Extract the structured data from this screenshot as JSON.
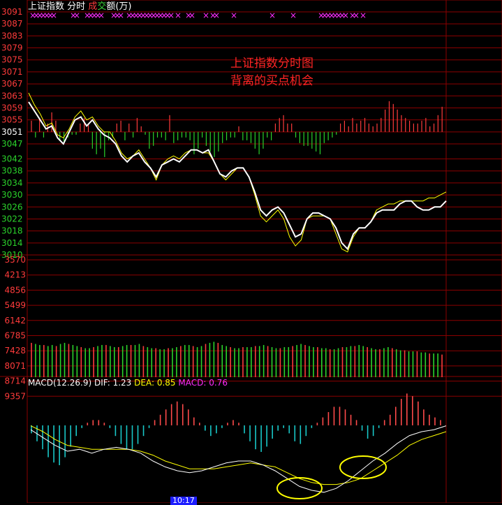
{
  "header": {
    "index_name": "上证指数",
    "mode": "分时",
    "turnover_part1": "成",
    "turnover_part2": "交",
    "turnover_part3": "额",
    "turnover_unit": "(万)"
  },
  "annotation": {
    "line1": "上证指数分时图",
    "line2": "背离的买点机会"
  },
  "price_axis": {
    "labels": [
      "3091",
      "3087",
      "3083",
      "3079",
      "3075",
      "3071",
      "3067",
      "3063",
      "3059",
      "3055",
      "3051",
      "3047",
      "3042",
      "3038",
      "3034",
      "3030",
      "3026",
      "3022",
      "3018",
      "3014",
      "3010"
    ],
    "prev_close": 3051
  },
  "volume_axis": {
    "labels": [
      "3570",
      "4213",
      "4856",
      "5499",
      "6142",
      "6785",
      "7428",
      "8071",
      "8714",
      "9357"
    ]
  },
  "macd": {
    "title": "MACD(12.26.9)",
    "dif_label": "DIF:",
    "dif_value": "1.23",
    "dea_label": "DEA:",
    "dea_value": "0.85",
    "macd_label": "MACD:",
    "macd_value": "0.76"
  },
  "time_axis": {
    "cursor_time": "10:17"
  },
  "colors": {
    "background": "#000000",
    "grid": "#8b0000",
    "up": "#ff3b3b",
    "down": "#2bd42b",
    "price_line": "#ffffff",
    "avg_line": "#ffff00",
    "macd_neg": "#19c8c8",
    "macd_pos": "#ff4a4a",
    "dea": "#ffff00",
    "dif": "#ffffff",
    "highlight": "#ffff00",
    "time_badge": "#1c1cff"
  },
  "chart_data": [
    {
      "type": "line",
      "title": "",
      "series": [
        {
          "name": "",
          "values": [
            3061,
            3058,
            3055,
            3052,
            3053,
            3049,
            3047,
            3051,
            3055,
            3056,
            3053,
            3055,
            3052,
            3050,
            3049,
            3047,
            3043,
            3041,
            3043,
            3044,
            3041,
            3039,
            3036,
            3040,
            3041,
            3042,
            3041,
            3043,
            3045,
            3045,
            3044,
            3045,
            3041,
            3037,
            3036,
            3038,
            3039,
            3039,
            3036,
            3031,
            3025,
            3023,
            3025,
            3026,
            3024,
            3020,
            3016,
            3017,
            3022,
            3024,
            3024,
            3023,
            3022,
            3019,
            3014,
            3012,
            3017,
            3019,
            3019,
            3021,
            3024,
            3025,
            3025,
            3025,
            3027,
            3028,
            3028,
            3026,
            3025,
            3025,
            3026,
            3026,
            3028
          ]
        },
        {
          "name": "",
          "values": [
            3064,
            3060,
            3057,
            3053,
            3054,
            3050,
            3049,
            3052,
            3056,
            3058,
            3055,
            3056,
            3053,
            3051,
            3051,
            3048,
            3044,
            3042,
            3043,
            3045,
            3042,
            3039,
            3035,
            3040,
            3042,
            3043,
            3042,
            3044,
            3045,
            3045,
            3044,
            3044,
            3041,
            3037,
            3035,
            3037,
            3039,
            3039,
            3036,
            3030,
            3023,
            3021,
            3023,
            3025,
            3022,
            3016,
            3013,
            3015,
            3022,
            3023,
            3023,
            3023,
            3022,
            3017,
            3012,
            3011,
            3016,
            3019,
            3019,
            3021,
            3025,
            3026,
            3027,
            3027,
            3028,
            3028,
            3028,
            3028,
            3028,
            3029,
            3029,
            3030,
            3031
          ]
        }
      ],
      "ylim": [
        3010,
        3091
      ],
      "reference_value": 3051
    },
    {
      "type": "bar",
      "title": "",
      "values": [
        4,
        -2,
        5,
        -2,
        3,
        7,
        4,
        -3,
        -4,
        -2,
        -1,
        -1,
        3,
        5,
        3,
        -6,
        -8,
        -6,
        -9,
        -3,
        -2,
        3,
        4,
        -3,
        3,
        -2,
        5,
        2,
        -1,
        -6,
        -5,
        -2,
        -2,
        -3,
        6,
        -4,
        -3,
        -2,
        -2,
        -3,
        -8,
        -6,
        -2,
        -5,
        -7,
        -9,
        -7,
        -4,
        -3,
        -2,
        -2,
        2,
        -3,
        -3,
        -4,
        -6,
        -8,
        -6,
        -2,
        -3,
        3,
        5,
        6,
        3,
        3,
        -2,
        -4,
        -5,
        -5,
        -6,
        -7,
        -8,
        -4,
        -3,
        -2,
        -1,
        3,
        4,
        2,
        5,
        3,
        4,
        5,
        3,
        2,
        3,
        5,
        8,
        11,
        10,
        8,
        6,
        5,
        4,
        3,
        3,
        4,
        5,
        2,
        3,
        6,
        9
      ]
    },
    {
      "type": "bar",
      "title": "",
      "values": [
        6800,
        6700,
        6600,
        6600,
        6500,
        6600,
        6500,
        6700,
        6800,
        6700,
        6600,
        6500,
        6400,
        6300,
        6300,
        6400,
        6500,
        6600,
        6600,
        6500,
        6400,
        6400,
        6500,
        6600,
        6600,
        6600,
        6700,
        6500,
        6400,
        6300,
        6300,
        6200,
        6200,
        6300,
        6300,
        6400,
        6500,
        6600,
        6600,
        6500,
        6400,
        6500,
        6700,
        6800,
        6900,
        6800,
        6600,
        6500,
        6400,
        6300,
        6300,
        6400,
        6400,
        6400,
        6500,
        6500,
        6600,
        6500,
        6400,
        6300,
        6300,
        6400,
        6400,
        6500,
        6600,
        6700,
        6600,
        6500,
        6400,
        6400,
        6300,
        6300,
        6200,
        6200,
        6300,
        6400,
        6400,
        6500,
        6500,
        6600,
        6500,
        6400,
        6300,
        6200,
        6200,
        6300,
        6400,
        6300,
        6200,
        6100,
        6100,
        6000,
        6000,
        6000,
        5900,
        5900,
        5800,
        5800,
        5800,
        5700
      ],
      "ylim": [
        3570,
        9357
      ]
    },
    {
      "type": "bar",
      "title": "",
      "values": [
        -0.3,
        -0.6,
        -0.9,
        -1.2,
        -1.4,
        -1.5,
        -1.2,
        -0.8,
        -0.4,
        -0.1,
        0.1,
        0.2,
        0.2,
        0.1,
        -0.1,
        -0.4,
        -0.7,
        -0.9,
        -0.9,
        -0.7,
        -0.4,
        -0.1,
        0.2,
        0.4,
        0.6,
        0.8,
        0.9,
        0.8,
        0.6,
        0.3,
        0.1,
        -0.2,
        -0.4,
        -0.3,
        -0.1,
        0.1,
        0.2,
        0.1,
        -0.3,
        -0.6,
        -0.9,
        -1.0,
        -0.8,
        -0.5,
        -0.2,
        -0.1,
        -0.3,
        -0.6,
        -0.7,
        -0.4,
        -0.1,
        0.1,
        0.3,
        0.5,
        0.7,
        0.7,
        0.6,
        0.4,
        0.2,
        -0.2,
        -0.5,
        -0.4,
        -0.1,
        0.2,
        0.4,
        0.7,
        1.0,
        1.2,
        1.1,
        0.9,
        0.6,
        0.4,
        0.3,
        0.2
      ],
      "series": [
        {
          "name": "DIF",
          "values": [
            1.6,
            1.2,
            0.8,
            0.5,
            0.6,
            0.4,
            0.6,
            0.7,
            0.6,
            0.4,
            0.0,
            -0.3,
            -0.5,
            -0.6,
            -0.5,
            -0.3,
            -0.1,
            0.0,
            0.0,
            -0.2,
            -0.5,
            -0.9,
            -1.3,
            -1.5,
            -1.6,
            -1.4,
            -1.0,
            -0.5,
            0.0,
            0.4,
            0.9,
            1.3,
            1.5,
            1.6,
            1.8
          ]
        },
        {
          "name": "DEA",
          "values": [
            1.8,
            1.5,
            1.1,
            0.8,
            0.7,
            0.6,
            0.6,
            0.6,
            0.6,
            0.5,
            0.3,
            0.0,
            -0.2,
            -0.4,
            -0.4,
            -0.4,
            -0.3,
            -0.2,
            -0.1,
            -0.2,
            -0.3,
            -0.6,
            -0.9,
            -1.1,
            -1.2,
            -1.2,
            -1.1,
            -0.9,
            -0.5,
            -0.1,
            0.3,
            0.8,
            1.1,
            1.3,
            1.5
          ]
        }
      ]
    }
  ]
}
